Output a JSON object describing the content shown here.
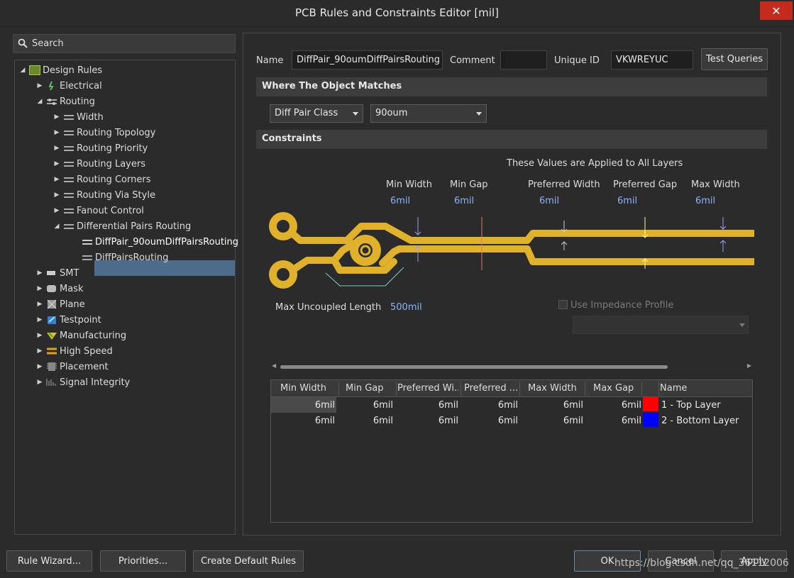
{
  "window": {
    "title": "PCB Rules and Constraints Editor [mil]"
  },
  "search": {
    "placeholder": "Search"
  },
  "tree": {
    "root": "Design Rules",
    "categories": [
      "Electrical",
      "Routing",
      "SMT",
      "Mask",
      "Plane",
      "Testpoint",
      "Manufacturing",
      "High Speed",
      "Placement",
      "Signal Integrity"
    ],
    "routing_children": [
      "Width",
      "Routing Topology",
      "Routing Priority",
      "Routing Layers",
      "Routing Corners",
      "Routing Via Style",
      "Fanout Control",
      "Differential Pairs Routing"
    ],
    "diff_pair_rules": [
      "DiffPair_90oumDiffPairsRouting",
      "DiffPairsRouting"
    ]
  },
  "rule": {
    "name_label": "Name",
    "name_value": "DiffPair_90oumDiffPairsRouting",
    "comment_label": "Comment",
    "comment_value": "",
    "unique_id_label": "Unique ID",
    "unique_id_value": "VKWREYUC",
    "test_queries": "Test Queries"
  },
  "where": {
    "header": "Where The Object Matches",
    "scope_type": "Diff Pair Class",
    "scope_value": "90oum"
  },
  "constraints": {
    "header": "Constraints",
    "applied_note": "These Values are Applied to All Layers",
    "min_width_label": "Min Width",
    "min_width": "6mil",
    "min_gap_label": "Min Gap",
    "min_gap": "6mil",
    "pref_width_label": "Preferred Width",
    "pref_width": "6mil",
    "pref_gap_label": "Preferred Gap",
    "pref_gap": "6mil",
    "max_width_label": "Max Width",
    "max_width": "6mil",
    "max_uncoupled_label": "Max Uncoupled Length",
    "max_uncoupled": "500mil",
    "use_impedance": "Use Impedance Profile"
  },
  "layer_table": {
    "columns": [
      "Min Width",
      "Min Gap",
      "Preferred Wi...",
      "Preferred ...",
      "Max Width",
      "Max Gap",
      "",
      "Name"
    ],
    "rows": [
      {
        "values": [
          "6mil",
          "6mil",
          "6mil",
          "6mil",
          "6mil",
          "6mil"
        ],
        "color": "#ff0000",
        "name": "1 - Top Layer"
      },
      {
        "values": [
          "6mil",
          "6mil",
          "6mil",
          "6mil",
          "6mil",
          "6mil"
        ],
        "color": "#0000ff",
        "name": "2 - Bottom Layer"
      }
    ]
  },
  "buttons": {
    "rule_wizard": "Rule Wizard...",
    "priorities": "Priorities...",
    "create_default": "Create Default Rules",
    "ok": "OK",
    "cancel": "Cancel",
    "apply": "Apply"
  },
  "watermark": "https://blog.csdn.net/qq_36112006",
  "colors": {
    "accent": "#4d6b8a",
    "trace": "#e0b12a",
    "value_blue": "#8ab4f8"
  }
}
